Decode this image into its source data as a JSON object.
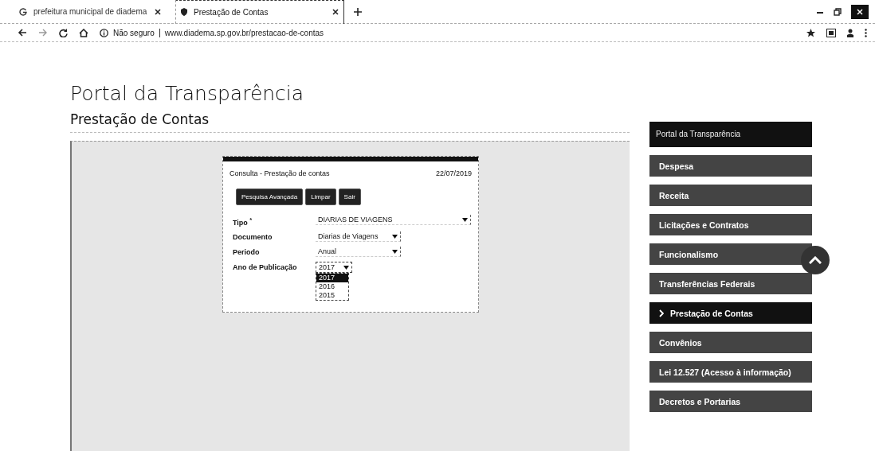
{
  "browser": {
    "tabs": [
      {
        "title": "prefeitura municipal de diadema",
        "selected": false
      },
      {
        "title": "Prestação de Contas",
        "selected": true
      }
    ],
    "security": "Não seguro",
    "url": "www.diadema.sp.gov.br/prestacao-de-contas"
  },
  "page": {
    "title": "Portal da Transparência",
    "subtitle": "Prestação de Contas"
  },
  "dialog": {
    "title": "Consulta - Prestação de contas",
    "date": "22/07/2019",
    "buttons": [
      "Pesquisa Avançada",
      "Limpar",
      "Sair"
    ],
    "fields": [
      {
        "label": "Tipo $^{*}$",
        "value": "DIARIAS DE VIAGENS",
        "kind": "wide"
      },
      {
        "label": "Documento",
        "value": "Diarias de Viagens",
        "kind": "medium"
      },
      {
        "label": "Periodo",
        "value": "Anual",
        "kind": "medium"
      },
      {
        "label": "Ano de Publicação",
        "value": "2017",
        "kind": "small",
        "expanded": true,
        "options": [
          {
            "label": "2017",
            "selected": true
          },
          {
            "label": "2016",
            "selected": false
          },
          {
            "label": "2015",
            "selected": false
          }
        ]
      }
    ]
  },
  "sidebar": {
    "header": "Portal da Transparência",
    "items": [
      {
        "label": "Despesa",
        "selected": false
      },
      {
        "label": "Receita",
        "selected": false
      },
      {
        "label": "Licitações e Contratos",
        "selected": false
      },
      {
        "label": "Funcionalismo",
        "selected": false
      },
      {
        "label": "Transferências Federais",
        "selected": false
      },
      {
        "label": "Prestação de Contas",
        "selected": true
      },
      {
        "label": "Convênios",
        "selected": false
      },
      {
        "label": "Lei 12.527 (Acesso à informação)",
        "selected": false
      },
      {
        "label": "Decretos e Portarias",
        "selected": false
      }
    ]
  }
}
